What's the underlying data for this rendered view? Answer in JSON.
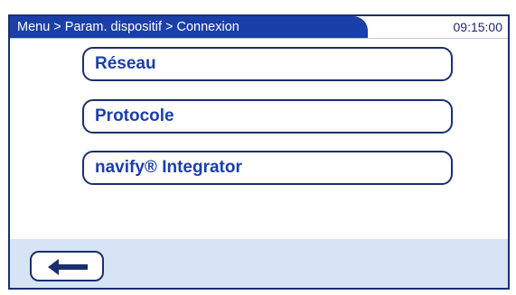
{
  "header": {
    "breadcrumb": "Menu > Param. dispositif > Connexion",
    "time": "09:15:00"
  },
  "menu": {
    "items": [
      {
        "label": "Réseau"
      },
      {
        "label": "Protocole"
      },
      {
        "label": "navify® Integrator"
      }
    ]
  },
  "footer": {
    "back_icon": "arrow-left-icon"
  },
  "colors": {
    "accent": "#1b3fa8",
    "border": "#1b2f6e",
    "footer_bg": "#d6e4f5"
  }
}
